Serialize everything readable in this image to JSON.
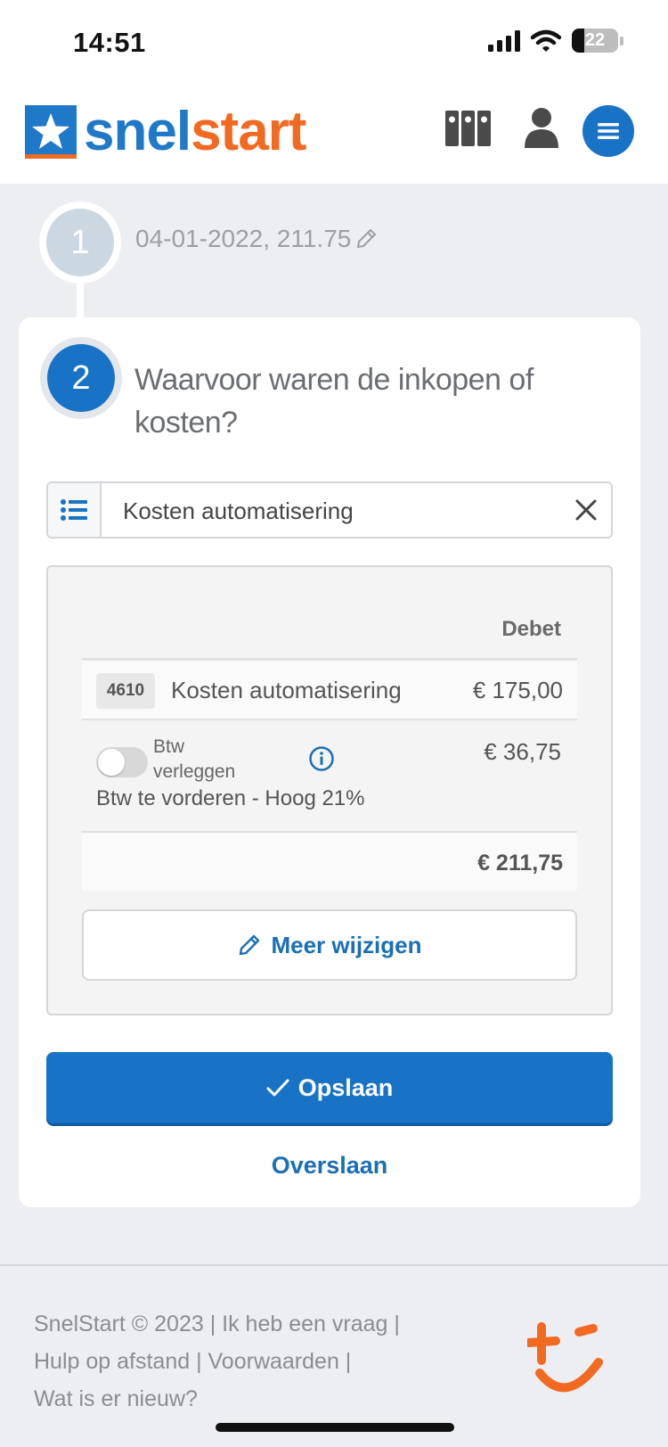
{
  "status_bar": {
    "time": "14:51",
    "battery": "22"
  },
  "header": {
    "logo_part1": "snel",
    "logo_part2": "start",
    "colors": {
      "brand_blue": "#1f78c8",
      "brand_orange": "#f26a21"
    }
  },
  "step1": {
    "number": "1",
    "summary": "04-01-2022, 211.75"
  },
  "step2": {
    "number": "2",
    "question": "Waarvoor waren de inkopen of kosten?",
    "account_value": "Kosten automatisering",
    "table": {
      "column_header": "Debet",
      "rows": [
        {
          "code": "4610",
          "name": "Kosten automatisering",
          "amount": "€ 175,00"
        }
      ],
      "vat": {
        "toggle_label": "Btw verleggen",
        "toggle_on": false,
        "amount": "€ 36,75",
        "rate_label": "Btw te vorderen - Hoog 21%"
      },
      "total": "€ 211,75"
    },
    "edit_more_label": "Meer wijzigen",
    "save_label": "Opslaan",
    "skip_label": "Overslaan"
  },
  "footer": {
    "links": [
      "SnelStart © 2023",
      "Ik heb een vraag",
      "Hulp op afstand",
      "Voorwaarden",
      "Wat is er nieuw?"
    ],
    "separator": " | "
  }
}
